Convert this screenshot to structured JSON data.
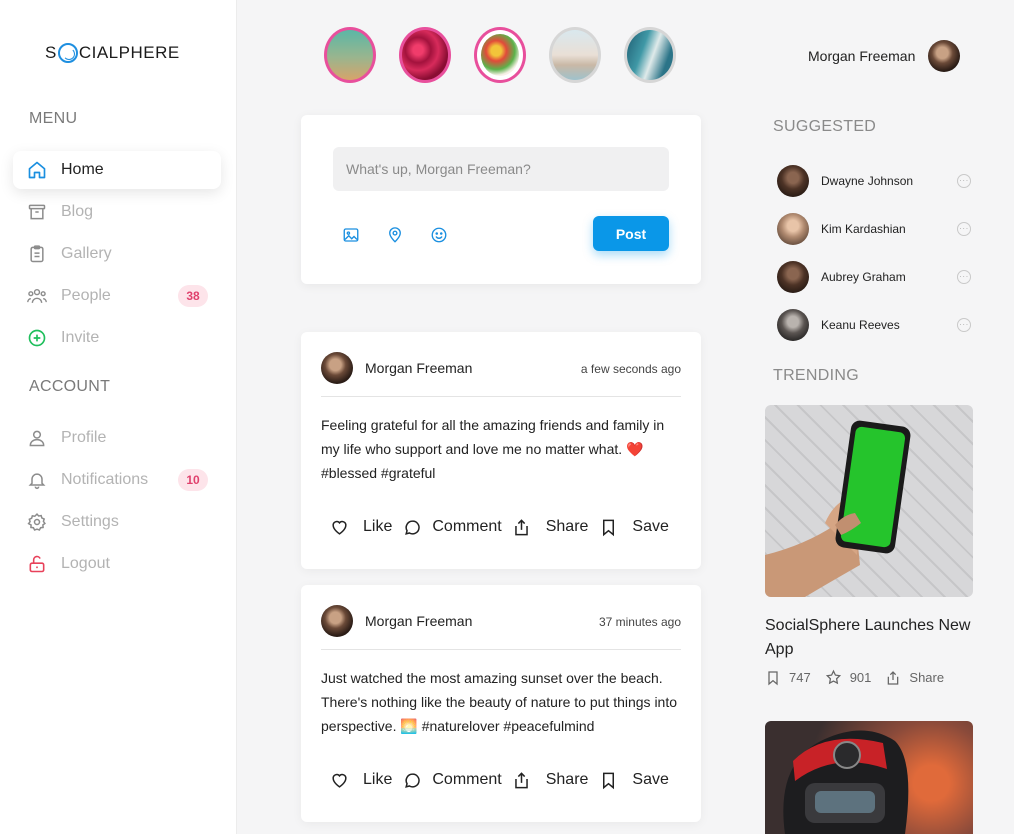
{
  "app": {
    "logo_left": "S",
    "logo_right": "CIALPHERE"
  },
  "sidebar": {
    "menu_title": "MENU",
    "account_title": "ACCOUNT",
    "menu_items": [
      {
        "label": "Home",
        "icon": "home-icon",
        "active": true
      },
      {
        "label": "Blog",
        "icon": "archive-icon"
      },
      {
        "label": "Gallery",
        "icon": "clipboard-icon"
      },
      {
        "label": "People",
        "icon": "people-icon",
        "badge": "38"
      },
      {
        "label": "Invite",
        "icon": "plus-circle-icon"
      }
    ],
    "account_items": [
      {
        "label": "Profile",
        "icon": "user-icon"
      },
      {
        "label": "Notifications",
        "icon": "bell-icon",
        "badge": "10"
      },
      {
        "label": "Settings",
        "icon": "gear-icon"
      },
      {
        "label": "Logout",
        "icon": "unlock-icon"
      }
    ]
  },
  "header": {
    "user_name": "Morgan Freeman"
  },
  "composer": {
    "placeholder": "What's up, Morgan Freeman?",
    "post_label": "Post"
  },
  "posts": [
    {
      "author": "Morgan Freeman",
      "time": "a few seconds ago",
      "text": "Feeling grateful for all the amazing friends and family in my life who support and love me no matter what. ❤️ #blessed #grateful",
      "like": "Like",
      "comment": "Comment",
      "share": "Share",
      "save": "Save"
    },
    {
      "author": "Morgan Freeman",
      "time": "37 minutes ago",
      "text": "Just watched the most amazing sunset over the beach. There's nothing like the beauty of nature to put things into perspective. 🌅 #naturelover #peacefulmind",
      "like": "Like",
      "comment": "Comment",
      "share": "Share",
      "save": "Save"
    }
  ],
  "suggested": {
    "title": "SUGGESTED",
    "people": [
      {
        "name": "Dwayne Johnson"
      },
      {
        "name": "Kim Kardashian"
      },
      {
        "name": "Aubrey Graham"
      },
      {
        "name": "Keanu Reeves"
      }
    ]
  },
  "trending": {
    "title": "TRENDING",
    "items": [
      {
        "title": "SocialSphere Launches New App",
        "bookmarks": "747",
        "stars": "901",
        "share": "Share"
      }
    ]
  },
  "colors": {
    "accent": "#0a97e8",
    "badge_bg": "#fde4ea",
    "badge_text": "#e0416d",
    "story_ring": "#e84f9c"
  }
}
